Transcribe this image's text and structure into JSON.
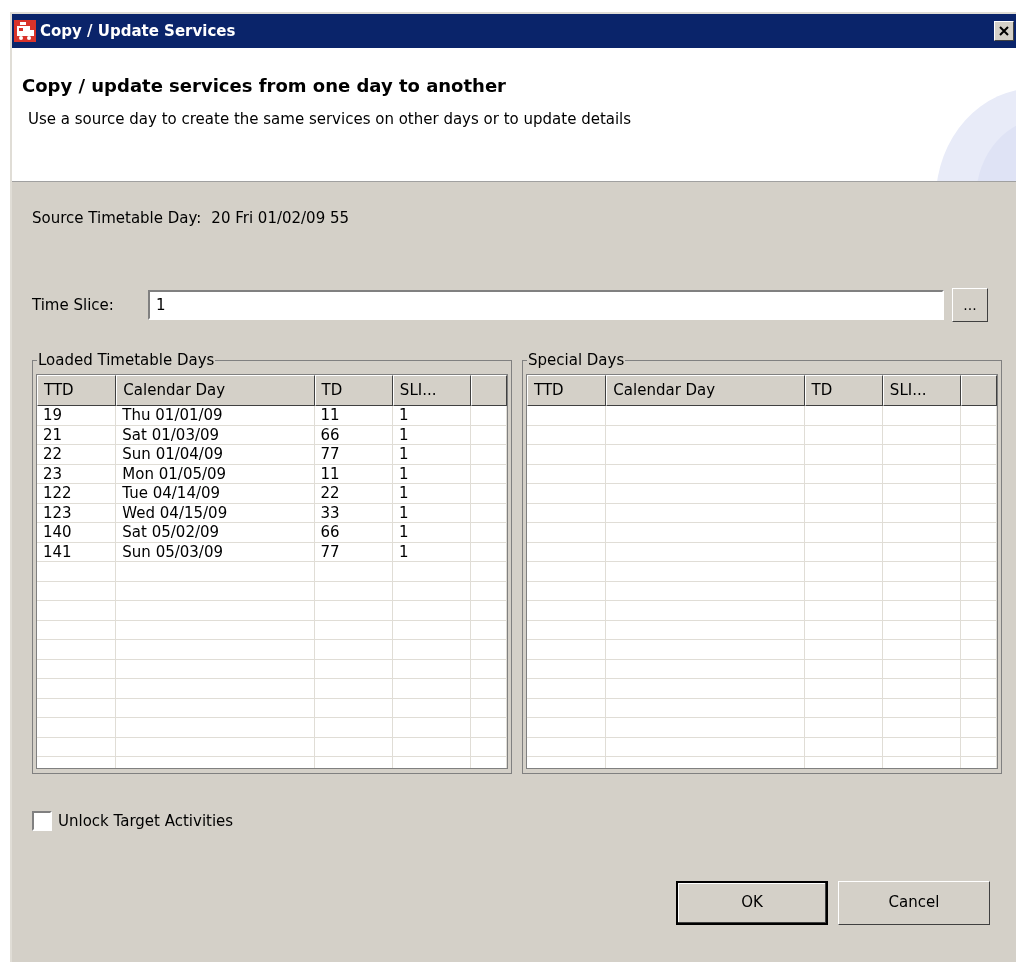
{
  "window": {
    "title": "Copy / Update Services"
  },
  "header": {
    "title": "Copy / update services from one day to another",
    "subtitle": "Use a source day to create the same services on other days or to update details"
  },
  "source": {
    "label": "Source Timetable Day:",
    "value": "20 Fri 01/02/09 55"
  },
  "time_slice": {
    "label": "Time Slice:",
    "value": "1",
    "browse_button": "..."
  },
  "tables": [
    {
      "title": "Loaded Timetable Days",
      "columns": [
        "TTD",
        "Calendar Day",
        "TD",
        "SLI..."
      ],
      "rows": [
        [
          "19",
          "Thu 01/01/09",
          "11",
          "1"
        ],
        [
          "21",
          "Sat 01/03/09",
          "66",
          "1"
        ],
        [
          "22",
          "Sun 01/04/09",
          "77",
          "1"
        ],
        [
          "23",
          "Mon 01/05/09",
          "11",
          "1"
        ],
        [
          "122",
          "Tue 04/14/09",
          "22",
          "1"
        ],
        [
          "123",
          "Wed 04/15/09",
          "33",
          "1"
        ],
        [
          "140",
          "Sat 05/02/09",
          "66",
          "1"
        ],
        [
          "141",
          "Sun 05/03/09",
          "77",
          "1"
        ]
      ]
    },
    {
      "title": "Special Days",
      "columns": [
        "TTD",
        "Calendar Day",
        "TD",
        "SLI..."
      ]
    }
  ],
  "unlock_checkbox": {
    "label": "Unlock Target Activities",
    "checked": false
  },
  "buttons": [
    "OK",
    "Cancel"
  ]
}
